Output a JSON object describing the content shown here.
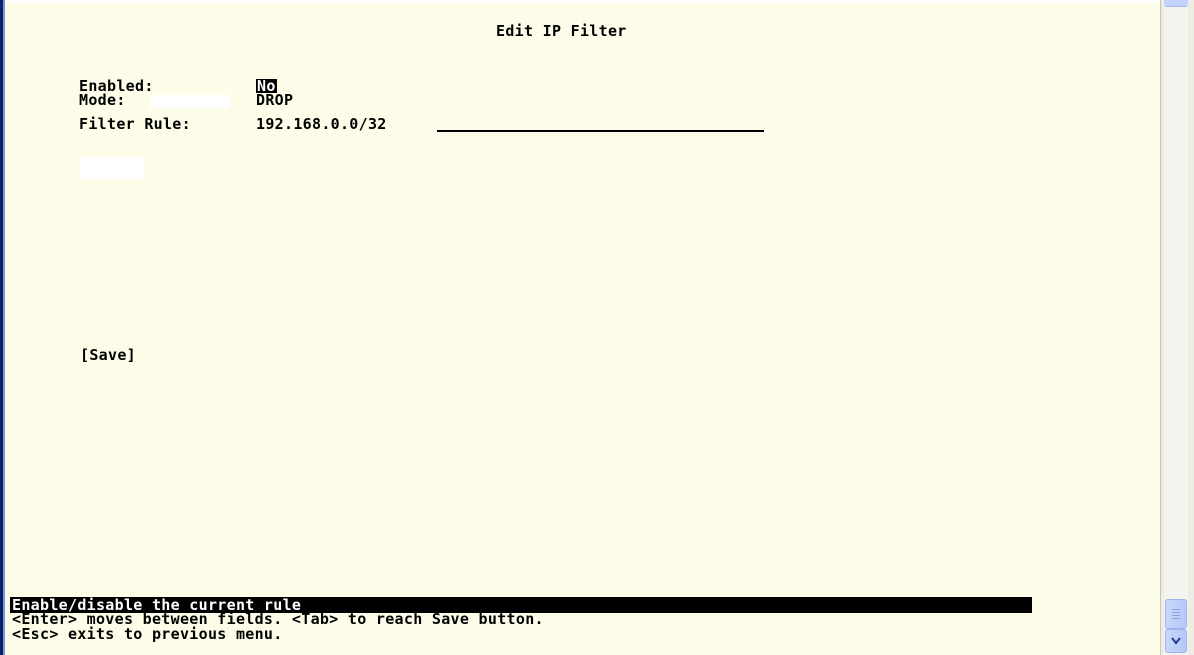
{
  "screen": {
    "title": "Edit IP Filter"
  },
  "form": {
    "enabled_label": "Enabled:",
    "enabled_value": "No",
    "mode_label": "Mode:",
    "mode_value": "DROP",
    "filter_rule_label": "Filter Rule:",
    "filter_rule_value": "192.168.0.0/32"
  },
  "actions": {
    "save_label": "[Save]"
  },
  "status": {
    "help_text": "Enable/disable the current rule",
    "hint_line_1": "<Enter> moves between fields. <Tab> to reach Save button.",
    "hint_line_2": "<Esc> exits to previous menu."
  },
  "icons": {
    "scroll_down": "chevron-down-icon",
    "scroll_thumb": "scrollbar-thumb"
  },
  "colors": {
    "background": "#fcfce8",
    "text": "#000000",
    "highlight_bg": "#000000",
    "highlight_text": "#ffffff",
    "window_border": "#0a246a",
    "scrollbar_accent": "#c3d3fd"
  }
}
